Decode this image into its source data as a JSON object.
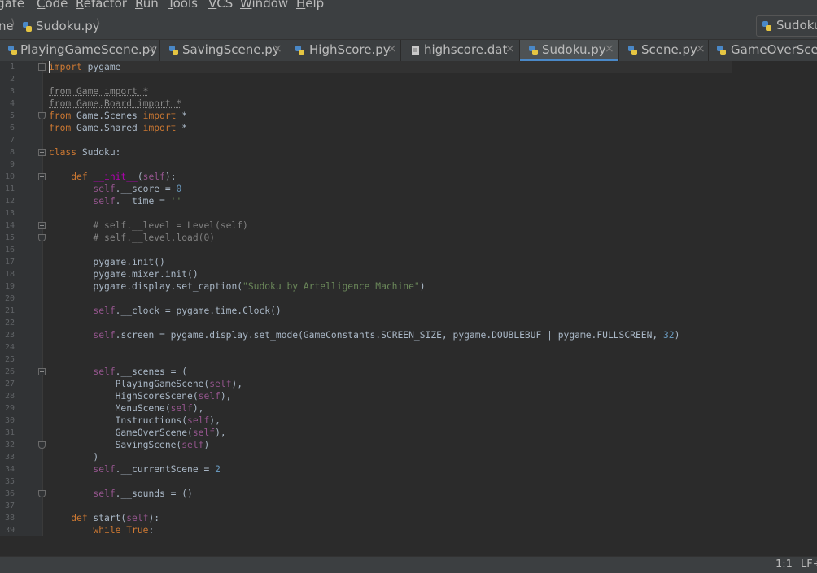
{
  "menubar": {
    "items": [
      "igate",
      "Code",
      "Refactor",
      "Run",
      "Tools",
      "VCS",
      "Window",
      "Help"
    ],
    "mnemonics": [
      "",
      "C",
      "R",
      "R",
      "T",
      "V",
      "W",
      "H"
    ]
  },
  "breadcrumb": {
    "prev": "ne",
    "file": "Sudoku.py"
  },
  "run_config": {
    "label": "Sudoku"
  },
  "tabs": [
    {
      "label": "PlayingGameScene.py",
      "active": false
    },
    {
      "label": "SavingScene.py",
      "active": false
    },
    {
      "label": "HighScore.py",
      "active": false
    },
    {
      "label": "highscore.dat",
      "active": false
    },
    {
      "label": "Sudoku.py",
      "active": true
    },
    {
      "label": "Scene.py",
      "active": false
    },
    {
      "label": "GameOverScen",
      "active": false
    }
  ],
  "close_glyph": "×",
  "editor": {
    "line_numbers": [
      "1",
      "2",
      "3",
      "4",
      "5",
      "6",
      "7",
      "8",
      "9",
      "10",
      "11",
      "12",
      "13",
      "14",
      "15",
      "16",
      "17",
      "18",
      "19",
      "20",
      "21",
      "22",
      "23",
      "24",
      "25",
      "26",
      "27",
      "28",
      "29",
      "30",
      "31",
      "32",
      "33",
      "34",
      "35",
      "36",
      "37",
      "38",
      "39"
    ],
    "code": [
      "import pygame",
      "",
      "from Game import *",
      "from Game.Board import *",
      "from Game.Scenes import *",
      "from Game.Shared import *",
      "",
      "class Sudoku:",
      "",
      "    def __init__(self):",
      "        self.__score = 0",
      "        self.__time = ''",
      "",
      "        # self.__level = Level(self)",
      "        # self.__level.load(0)",
      "",
      "        pygame.init()",
      "        pygame.mixer.init()",
      "        pygame.display.set_caption(\"Sudoku by Artelligence Machine\")",
      "",
      "        self.__clock = pygame.time.Clock()",
      "",
      "        self.screen = pygame.display.set_mode(GameConstants.SCREEN_SIZE, pygame.DOUBLEBUF | pygame.FULLSCREEN, 32)",
      "",
      "",
      "        self.__scenes = (",
      "            PlayingGameScene(self),",
      "            HighScoreScene(self),",
      "            MenuScene(self),",
      "            Instructions(self),",
      "            GameOverScene(self),",
      "            SavingScene(self)",
      "        )",
      "        self.__currentScene = 2",
      "",
      "        self.__sounds = ()",
      "",
      "    def start(self):",
      "        while True:"
    ]
  },
  "status": {
    "position": "1:1",
    "line_sep": "LF÷"
  },
  "colors": {
    "background": "#2b2b2b",
    "keyword": "#cc7832",
    "string": "#6a8759",
    "number": "#6897bb",
    "comment": "#808080",
    "self": "#94558d",
    "accent": "#4a88c7"
  }
}
